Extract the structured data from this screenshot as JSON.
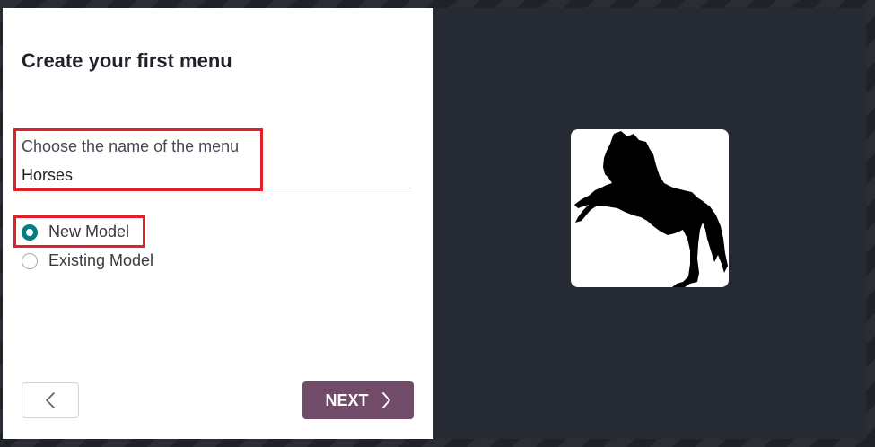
{
  "dialog": {
    "title": "Create your first menu",
    "menu_name_label": "Choose the name of the menu",
    "menu_name_value": "Horses",
    "model_options": [
      {
        "label": "New Model",
        "checked": true
      },
      {
        "label": "Existing Model",
        "checked": false
      }
    ],
    "back_icon": "chevron-left-icon",
    "next_label": "NEXT",
    "next_icon": "chevron-right-icon",
    "menu_icon": "horse-icon",
    "colors": {
      "primary": "#714b67",
      "radio_checked": "#017e84",
      "highlight": "#e0202a",
      "right_panel": "#262a33"
    }
  }
}
